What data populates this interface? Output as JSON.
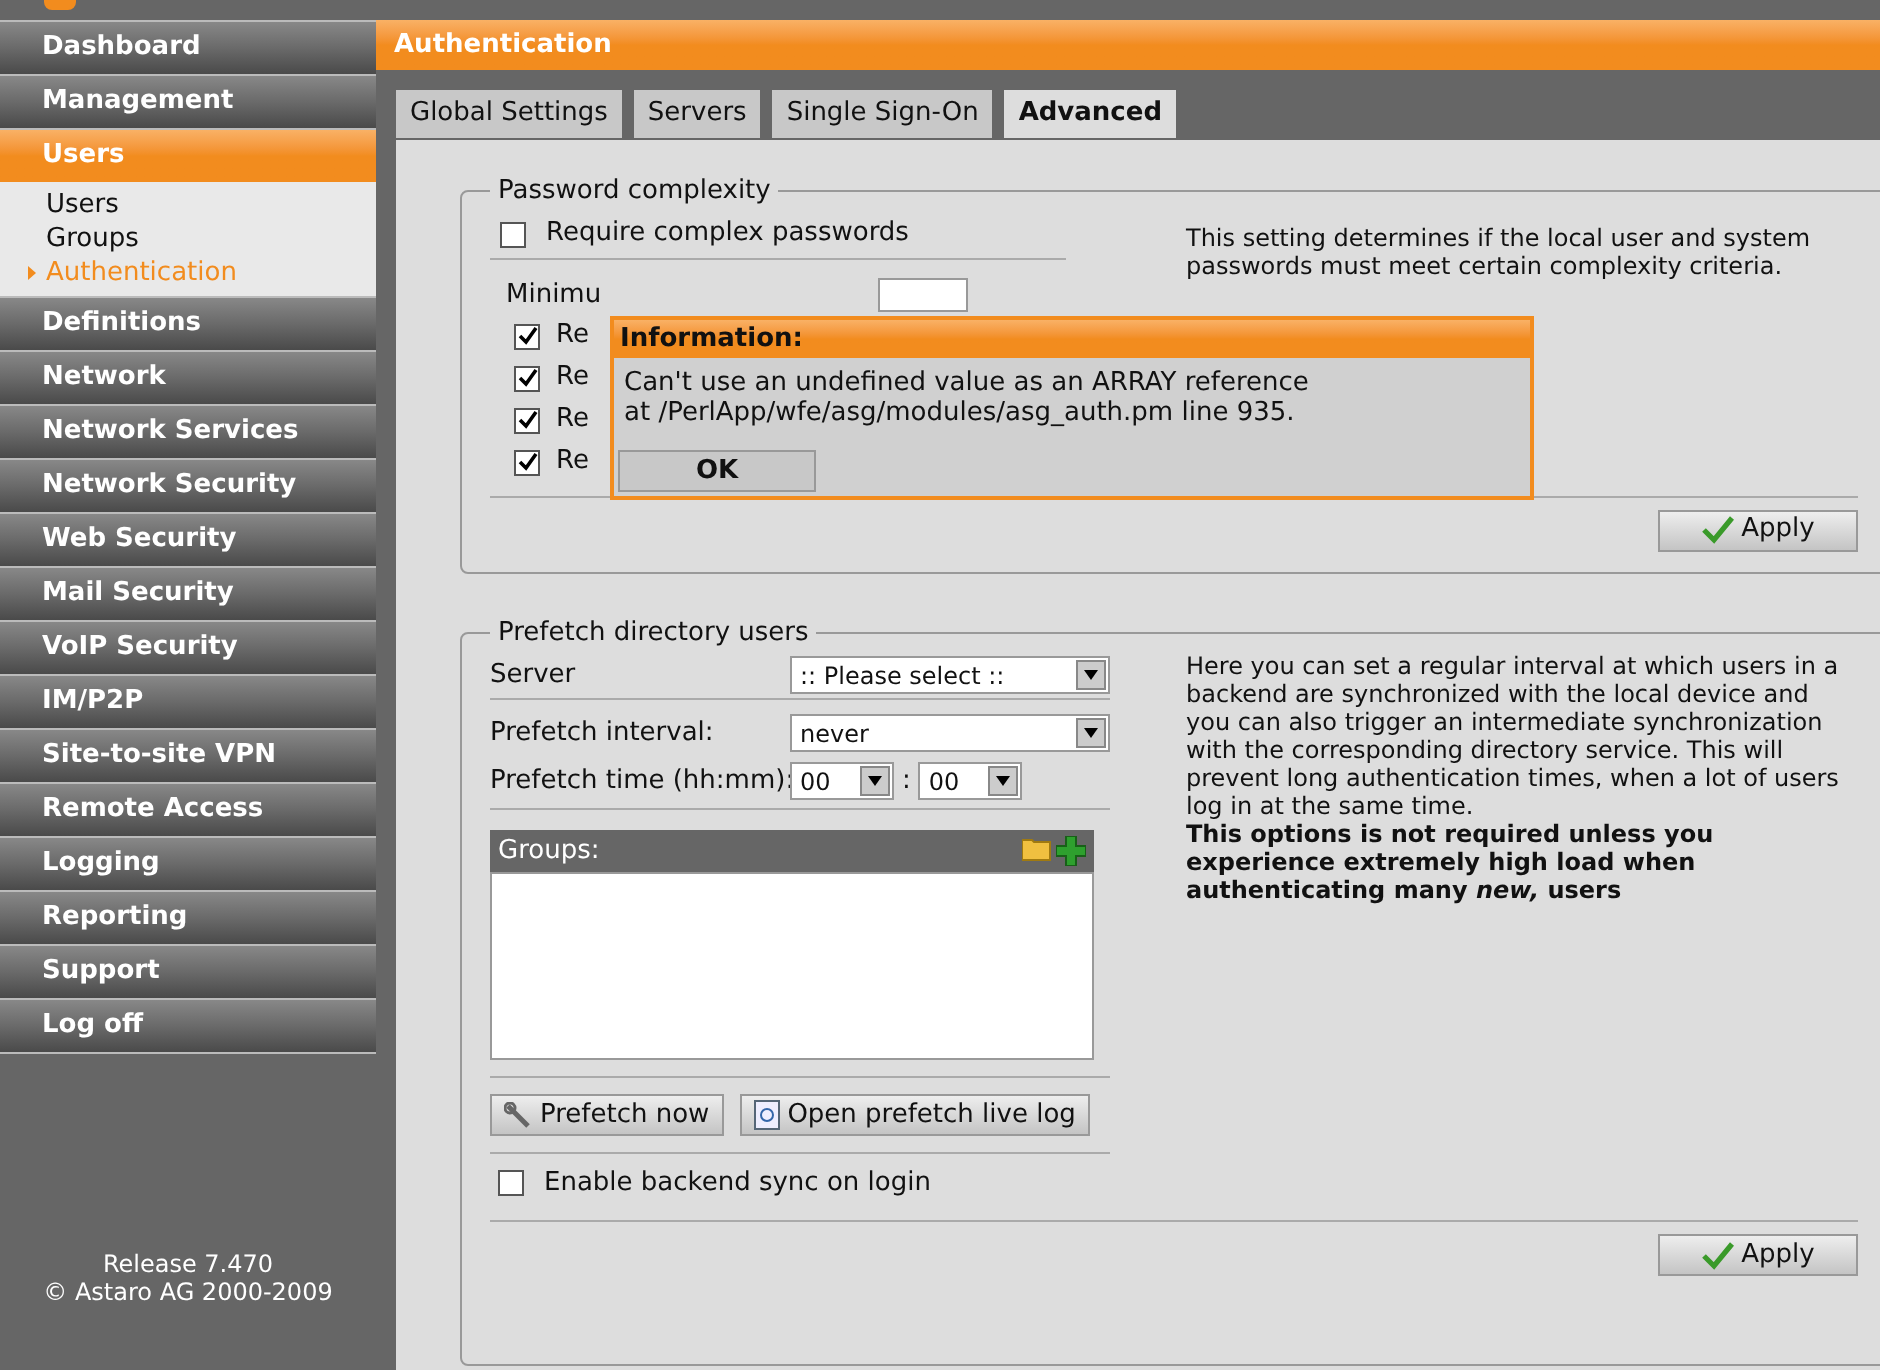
{
  "sidebar": {
    "items": [
      {
        "label": "Dashboard",
        "selected": false
      },
      {
        "label": "Management",
        "selected": false
      },
      {
        "label": "Users",
        "selected": true,
        "children": [
          {
            "label": "Users",
            "selected": false
          },
          {
            "label": "Groups",
            "selected": false
          },
          {
            "label": "Authentication",
            "selected": true
          }
        ]
      },
      {
        "label": "Definitions",
        "selected": false
      },
      {
        "label": "Network",
        "selected": false
      },
      {
        "label": "Network Services",
        "selected": false
      },
      {
        "label": "Network Security",
        "selected": false
      },
      {
        "label": "Web Security",
        "selected": false
      },
      {
        "label": "Mail Security",
        "selected": false
      },
      {
        "label": "VoIP Security",
        "selected": false
      },
      {
        "label": "IM/P2P",
        "selected": false
      },
      {
        "label": "Site-to-site VPN",
        "selected": false
      },
      {
        "label": "Remote Access",
        "selected": false
      },
      {
        "label": "Logging",
        "selected": false
      },
      {
        "label": "Reporting",
        "selected": false
      },
      {
        "label": "Support",
        "selected": false
      },
      {
        "label": "Log off",
        "selected": false
      }
    ],
    "release": "Release 7.470",
    "copyright": "© Astaro AG 2000-2009"
  },
  "page_title": "Authentication",
  "tabs": [
    {
      "label": "Global Settings",
      "selected": false
    },
    {
      "label": "Servers",
      "selected": false
    },
    {
      "label": "Single Sign-On",
      "selected": false
    },
    {
      "label": "Advanced",
      "selected": true
    }
  ],
  "password_complexity": {
    "legend": "Password complexity",
    "require": {
      "label": "Require complex passwords",
      "checked": false
    },
    "min_length_label": "Minimu",
    "rules": [
      {
        "label": "Re",
        "checked": true
      },
      {
        "label": "Re",
        "checked": true
      },
      {
        "label": "Re",
        "checked": true
      },
      {
        "label": "Re",
        "checked": true
      }
    ],
    "description": "This setting determines if the local user and system passwords must meet certain complexity criteria.",
    "apply": "Apply"
  },
  "dialog": {
    "title": "Information:",
    "lines": [
      "Can't use an undefined value as an ARRAY reference",
      "at /PerlApp/wfe/asg/modules/asg_auth.pm line 935."
    ],
    "button": "OK"
  },
  "prefetch": {
    "legend": "Prefetch directory users",
    "server_label": "Server",
    "server_value": ":: Please select ::",
    "interval_label": "Prefetch interval:",
    "interval_value": "never",
    "time_label": "Prefetch time (hh:mm):",
    "hours": "00",
    "separator": ":",
    "minutes": "00",
    "groups_label": "Groups:",
    "prefetch_now": "Prefetch now",
    "open_log": "Open prefetch live log",
    "sync": {
      "label": "Enable backend sync on login",
      "checked": false
    },
    "description": "Here you can set a regular interval at which users in a backend are synchronized with the local device and you can also trigger an intermediate synchronization with the corresponding directory service. This will prevent long authentication times, when a lot of users log in at the same time.",
    "note": "This options is not required unless you experience extremely high load when authenticating many *new,* users",
    "apply": "Apply"
  }
}
